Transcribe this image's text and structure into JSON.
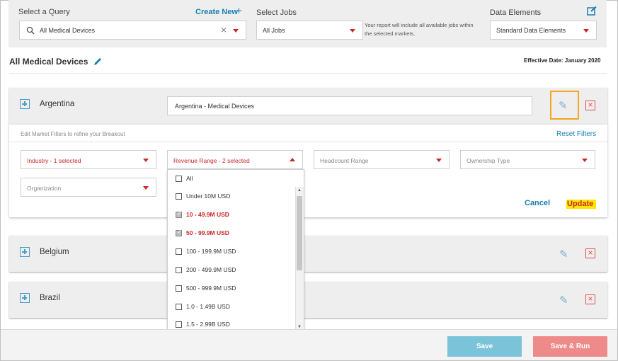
{
  "query": {
    "label": "Select a Query",
    "create_new": "Create New",
    "value": "All Medical Devices"
  },
  "jobs": {
    "label": "Select Jobs",
    "value": "All Jobs",
    "note": "Your report will include all available jobs within the selected markets."
  },
  "data_elements": {
    "label": "Data Elements",
    "value": "Standard Data Elements"
  },
  "page": {
    "title": "All Medical Devices",
    "effective_date": "Effective Date: January 2020"
  },
  "markets": [
    {
      "name": "Argentina",
      "breakout": "Argentina - Medical Devices"
    },
    {
      "name": "Belgium"
    },
    {
      "name": "Brazil"
    }
  ],
  "filters": {
    "hint": "Edit Market Filters to refine your Breakout",
    "reset": "Reset Filters",
    "industry": "Industry - 1 selected",
    "revenue": "Revenue Range - 2 selected",
    "headcount": "Headcount Range",
    "ownership": "Ownership Type",
    "organization": "Organization",
    "cancel": "Cancel",
    "update": "Update"
  },
  "revenue_options": [
    {
      "label": "All",
      "checked": false
    },
    {
      "label": "Under 10M USD",
      "checked": false
    },
    {
      "label": "10 - 49.9M USD",
      "checked": true
    },
    {
      "label": "50 - 99.9M USD",
      "checked": true
    },
    {
      "label": "100 - 199.9M USD",
      "checked": false
    },
    {
      "label": "200 - 499.9M USD",
      "checked": false
    },
    {
      "label": "500 - 999.9M USD",
      "checked": false
    },
    {
      "label": "1.0 - 1.49B USD",
      "checked": false
    },
    {
      "label": "1.5 - 2.99B USD",
      "checked": false
    }
  ],
  "footer": {
    "save": "Save",
    "save_run": "Save & Run"
  },
  "colors": {
    "accent": "#1a80b0",
    "danger": "#c62828",
    "highlight": "#f5a623",
    "save_button": "#7bc3d8",
    "save_run_button": "#ee8a8a"
  }
}
